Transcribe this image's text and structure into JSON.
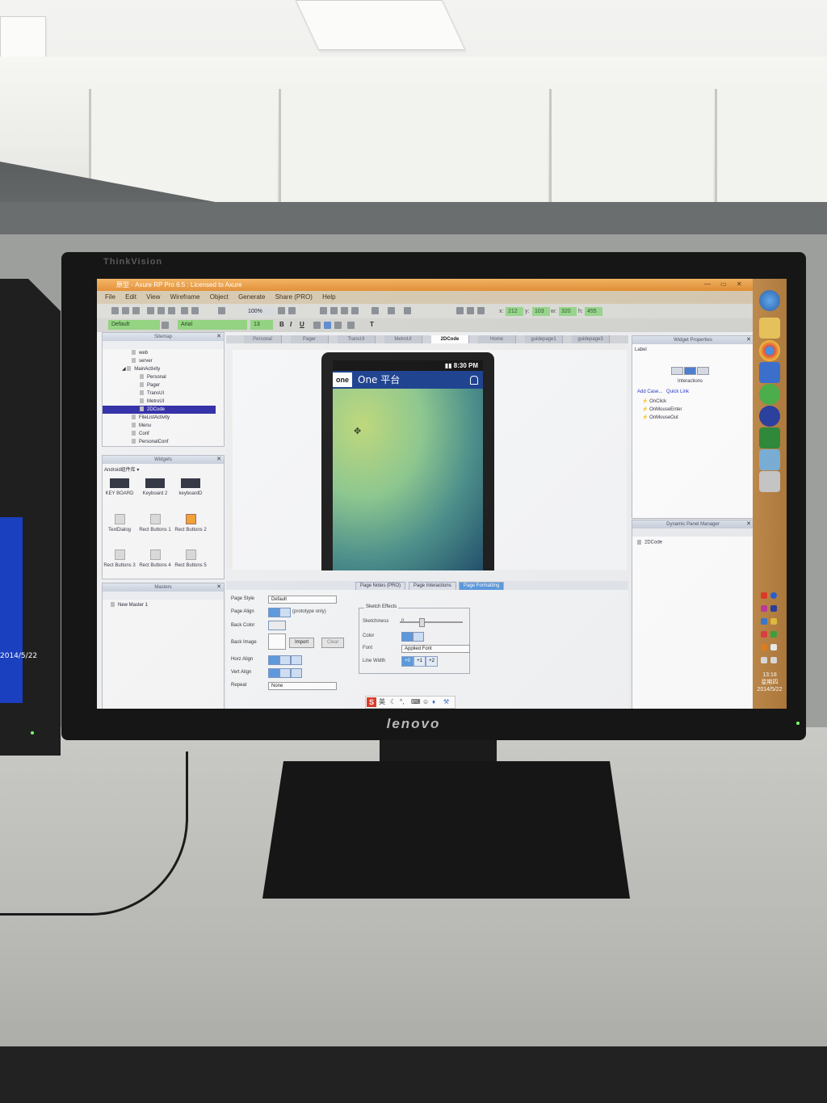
{
  "app": {
    "title": "原型 - Axure RP Pro 6.5 : Licensed to Axure",
    "menu": [
      "File",
      "Edit",
      "View",
      "Wireframe",
      "Object",
      "Generate",
      "Share (PRO)",
      "Help"
    ]
  },
  "toolbar": {
    "zoom": "100%",
    "x_label": "x:",
    "x_value": "212",
    "y_label": "y:",
    "y_value": "103",
    "w_label": "w:",
    "w_value": "320",
    "h_label": "h:",
    "h_value": "455",
    "style": "Default",
    "font": "Arial",
    "font_size": "13"
  },
  "sitemap": {
    "header": "Sitemap",
    "items": [
      "web",
      "server",
      "MainActivity",
      "Personal",
      "Pager",
      "TransUI",
      "MetroUI",
      "2DCode",
      "FileListActivity",
      "Menu",
      "Conf",
      "PersonalConf"
    ],
    "selected": "2DCode"
  },
  "widgets": {
    "header": "Widgets",
    "library": "Android组件库",
    "items": [
      {
        "label": "KEY BOARD"
      },
      {
        "label": "Keyboard 2"
      },
      {
        "label": "keyboardD"
      },
      {
        "label": "TextDialog"
      },
      {
        "label": "Rect Buttons 1"
      },
      {
        "label": "Rect Buttons 2"
      },
      {
        "label": "Rect Buttons 3"
      },
      {
        "label": "Rect Buttons 4"
      },
      {
        "label": "Rect Buttons 5"
      }
    ]
  },
  "masters": {
    "header": "Masters",
    "items": [
      "New Master 1"
    ]
  },
  "tabs": [
    "Personal",
    "Pager",
    "TransUI",
    "MetroUI",
    "2DCode",
    "Home",
    "guidepage1",
    "guidepage3"
  ],
  "active_tab": "2DCode",
  "phone": {
    "time": "8:30 PM",
    "tab": "one",
    "title": "One 平台"
  },
  "bottom_tabs": [
    "Page Notes (PRO)",
    "Page Interactions",
    "Page Formatting"
  ],
  "page_formatting": {
    "page_style_label": "Page Style",
    "page_style": "Default",
    "page_align_label": "Page Align",
    "page_align_note": "(prototype only)",
    "back_color_label": "Back Color",
    "back_image_label": "Back Image",
    "import_label": "Import",
    "clear_label": "Clear",
    "horz_align_label": "Horz Align",
    "vert_align_label": "Vert Align",
    "repeat_label": "Repeat",
    "repeat": "None",
    "sketch_title": "Sketch Effects",
    "sketchiness_label": "Sketchiness",
    "sketchiness": "0",
    "color_label": "Color",
    "font_label": "Font",
    "font": "Applied Font",
    "line_width_label": "Line Width",
    "line_widths": [
      "+0",
      "+1",
      "+2"
    ]
  },
  "widget_properties": {
    "header": "Widget Properties",
    "label": "Label",
    "interactions": "Interactions",
    "add_case": "Add Case...",
    "quick_link": "Quick Link",
    "events": [
      "OnClick",
      "OnMouseEnter",
      "OnMouseOut"
    ]
  },
  "dynamic_panel": {
    "header": "Dynamic Panel Manager",
    "items": [
      "2DCode"
    ]
  },
  "taskbar": {
    "time": "13:18",
    "weekday": "星期四",
    "date": "2014/5/22"
  },
  "ime": {
    "label": "英"
  },
  "monitor": {
    "model": "ThinkVision",
    "brand": "lenovo"
  },
  "left_monitor": {
    "date": "2014/5/22"
  }
}
